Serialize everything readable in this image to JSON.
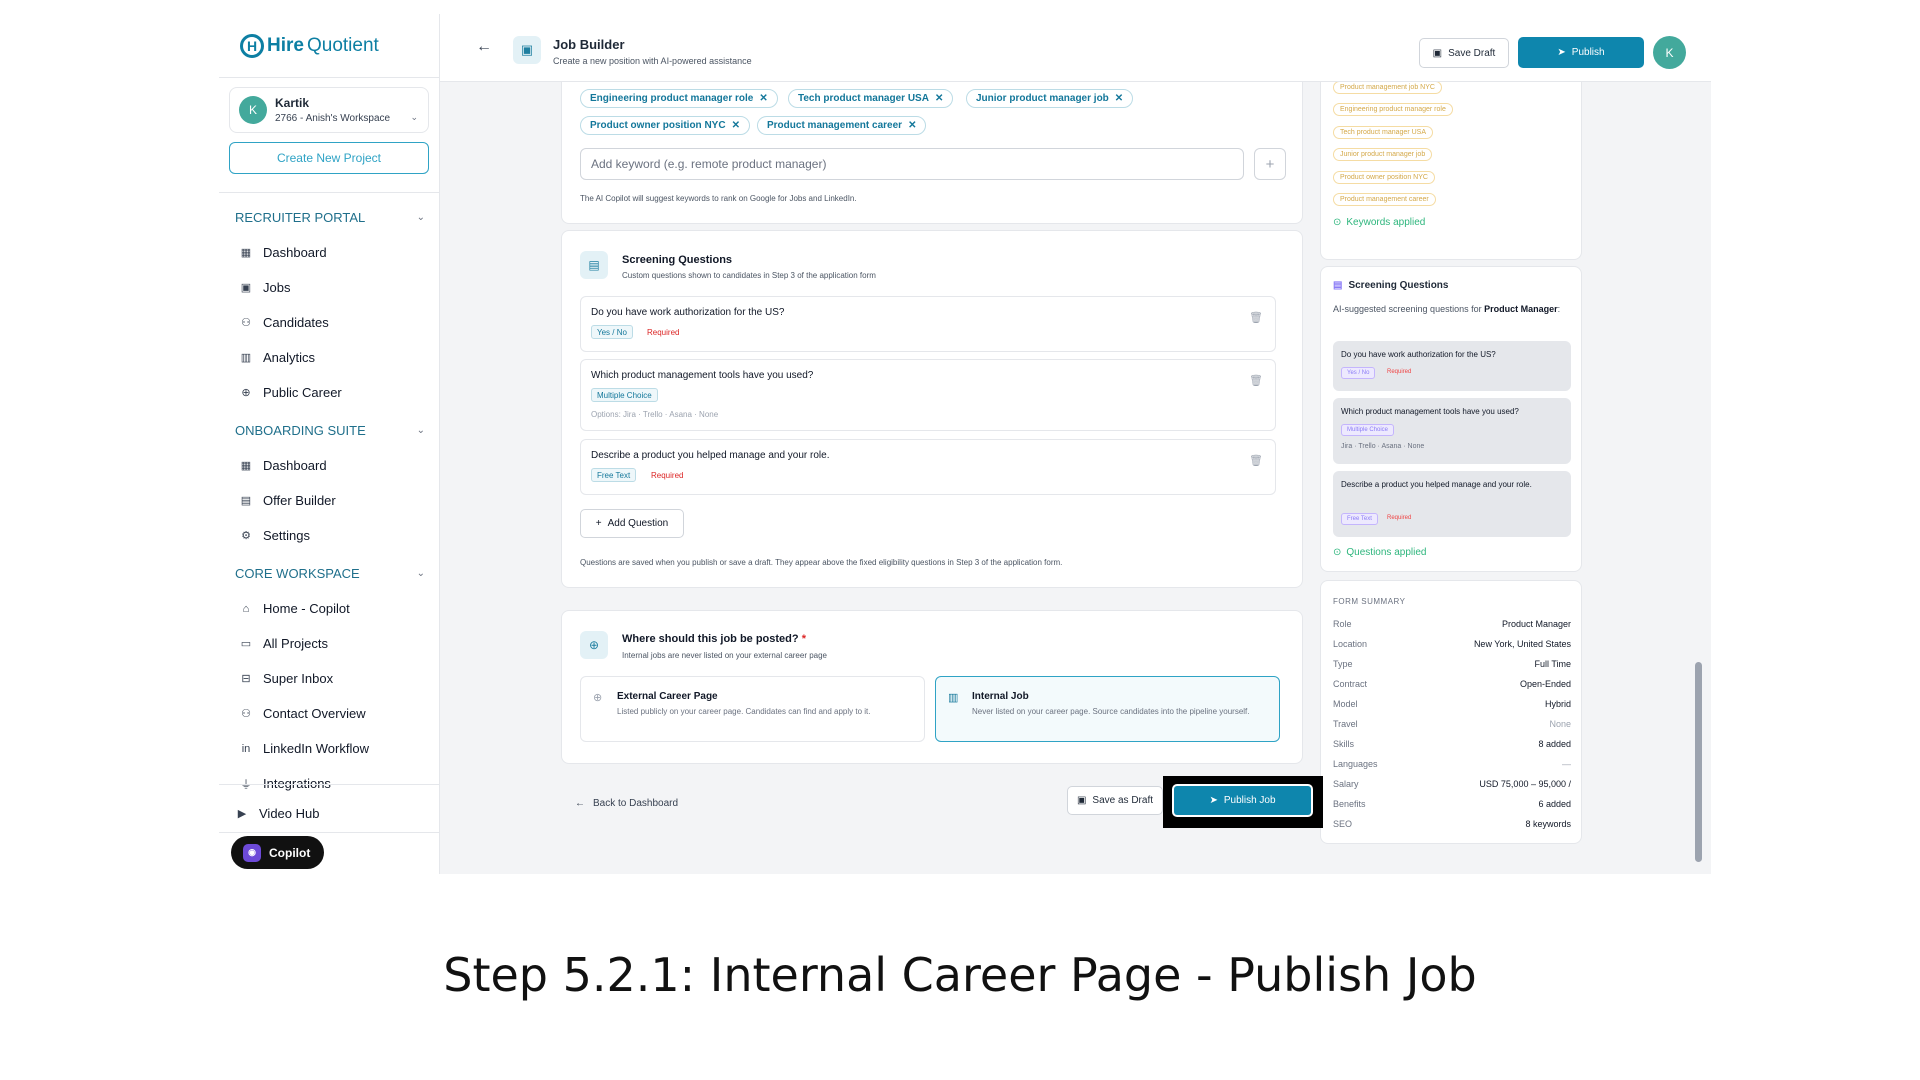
{
  "brand": {
    "logo_hire": "Hire",
    "logo_quotient": "Quotient"
  },
  "workspace": {
    "avatar": "K",
    "name": "Kartik",
    "sub": "2766 - Anish's Workspace"
  },
  "sidebar": {
    "create_project": "Create New Project",
    "sections": [
      {
        "title": "RECRUITER PORTAL",
        "items": [
          "Dashboard",
          "Jobs",
          "Candidates",
          "Analytics",
          "Public Career"
        ]
      },
      {
        "title": "ONBOARDING SUITE",
        "items": [
          "Dashboard",
          "Offer Builder",
          "Settings"
        ]
      },
      {
        "title": "CORE WORKSPACE",
        "items": [
          "Home - Copilot",
          "All Projects",
          "Super Inbox",
          "Contact Overview",
          "LinkedIn Workflow",
          "Integrations"
        ]
      }
    ],
    "video_hub": "Video Hub",
    "copilot": "Copilot"
  },
  "header": {
    "title": "Job Builder",
    "subtitle": "Create a new position with AI-powered assistance",
    "save_draft": "Save Draft",
    "publish": "Publish",
    "avatar": "K"
  },
  "keywords": {
    "chips": [
      "Engineering product manager role",
      "Tech product manager USA",
      "Junior product manager job",
      "Product owner position NYC",
      "Product management career"
    ],
    "placeholder": "Add keyword (e.g. remote product manager)",
    "note": "The AI Copilot will suggest keywords to rank on Google for Jobs and LinkedIn."
  },
  "screening": {
    "title": "Screening Questions",
    "subtitle": "Custom questions shown to candidates in Step 3 of the application form",
    "questions": [
      {
        "text": "Do you have work authorization for the US?",
        "type": "Yes / No",
        "required": "Required"
      },
      {
        "text": "Which product management tools have you used?",
        "type": "Multiple Choice",
        "options": "Options: Jira · Trello · Asana · None"
      },
      {
        "text": "Describe a product you helped manage and your role.",
        "type": "Free Text",
        "required": "Required"
      }
    ],
    "add_question": "Add Question",
    "note": "Questions are saved when you publish or save a draft. They appear above the fixed eligibility questions in Step 3 of the application form."
  },
  "posting": {
    "title": "Where should this job be posted?",
    "required_mark": "*",
    "subtitle": "Internal jobs are never listed on your external career page",
    "options": [
      {
        "title": "External Career Page",
        "desc": "Listed publicly on your career page. Candidates can find and apply to it."
      },
      {
        "title": "Internal Job",
        "desc": "Never listed on your career page. Source candidates into the pipeline yourself."
      }
    ],
    "selected": "Internal Job"
  },
  "footer": {
    "back": "Back to Dashboard",
    "save_draft": "Save as Draft",
    "publish": "Publish Job"
  },
  "right_keywords": {
    "chips": [
      "Product management job NYC",
      "Engineering product manager role",
      "Tech product manager USA",
      "Junior product manager job",
      "Product owner position NYC",
      "Product management career"
    ],
    "applied": "Keywords applied"
  },
  "right_screening": {
    "title": "Screening Questions",
    "intro": "AI-suggested screening questions for",
    "role": "Product Manager",
    "intro_end": ":",
    "questions": [
      {
        "text": "Do you have work authorization for the US?",
        "type": "Yes / No",
        "required": "Required"
      },
      {
        "text": "Which product management tools have you used?",
        "type": "Multiple Choice",
        "options": "Jira · Trello · Asana · None"
      },
      {
        "text": "Describe a product you helped manage and your role.",
        "type": "Free Text",
        "required": "Required"
      }
    ],
    "applied": "Questions applied"
  },
  "summary": {
    "title": "FORM SUMMARY",
    "rows": [
      {
        "k": "Role",
        "v": "Product Manager"
      },
      {
        "k": "Location",
        "v": "New York, United States"
      },
      {
        "k": "Type",
        "v": "Full Time"
      },
      {
        "k": "Contract",
        "v": "Open-Ended"
      },
      {
        "k": "Model",
        "v": "Hybrid"
      },
      {
        "k": "Travel",
        "v": "None"
      },
      {
        "k": "Skills",
        "v": "8 added"
      },
      {
        "k": "Languages",
        "v": "—"
      },
      {
        "k": "Salary",
        "v": "USD 75,000 – 95,000 /"
      },
      {
        "k": "Benefits",
        "v": "6 added"
      },
      {
        "k": "SEO",
        "v": "8 keywords"
      }
    ]
  },
  "caption": "Step 5.2.1: Internal Career Page - Publish Job",
  "colors": {
    "accent": "#0e86ad",
    "success": "#2eb67d",
    "required": "#dc2626"
  }
}
